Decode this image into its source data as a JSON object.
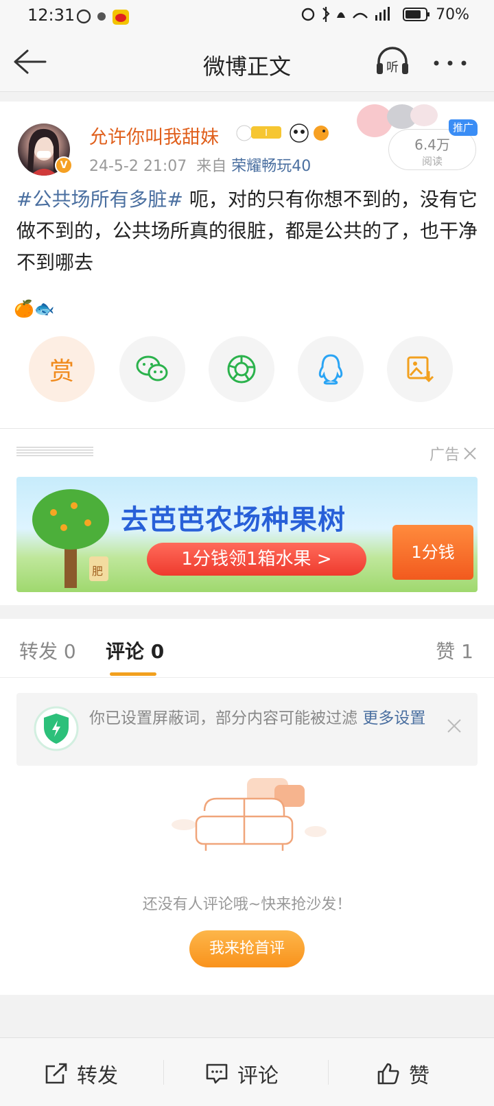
{
  "status_bar": {
    "time": "12:31",
    "battery": "70%",
    "network": "4G"
  },
  "nav": {
    "title": "微博正文"
  },
  "post": {
    "username": "允许你叫我甜妹",
    "date": "24-5-2 21:07",
    "from_label": "来自",
    "source": "荣耀畅玩40",
    "reads": "6.4万",
    "reads_label": "阅读",
    "promo_tag": "推广",
    "topic": "#公共场所有多脏#",
    "body": " 呃，对的只有你想不到的，没有它做不到的，公共场所真的很脏，都是公共的了，也干净不到哪去",
    "emojis": "🍊🐟",
    "reward_label": "赏"
  },
  "ad": {
    "label": "广告",
    "headline": "去芭芭农场种果树",
    "cta": "1分钱领1箱水果 >",
    "box_text": "1分钱",
    "tree_tag": "肥"
  },
  "comments": {
    "tabs": [
      {
        "label": "转发 0"
      },
      {
        "label": "评论 0"
      },
      {
        "label": "赞 1"
      }
    ],
    "notice_text": "你已设置屏蔽词，部分内容可能被过滤 ",
    "notice_link": "更多设置",
    "empty_text": "还没有人评论哦~快来抢沙发！",
    "first_button": "我来抢首评"
  },
  "bottom_bar": {
    "repost": "转发",
    "comment": "评论",
    "like": "赞"
  },
  "colors": {
    "accent_orange": "#f2a01e",
    "link_blue": "#4a6fa0",
    "username_orange": "#e0601d"
  }
}
